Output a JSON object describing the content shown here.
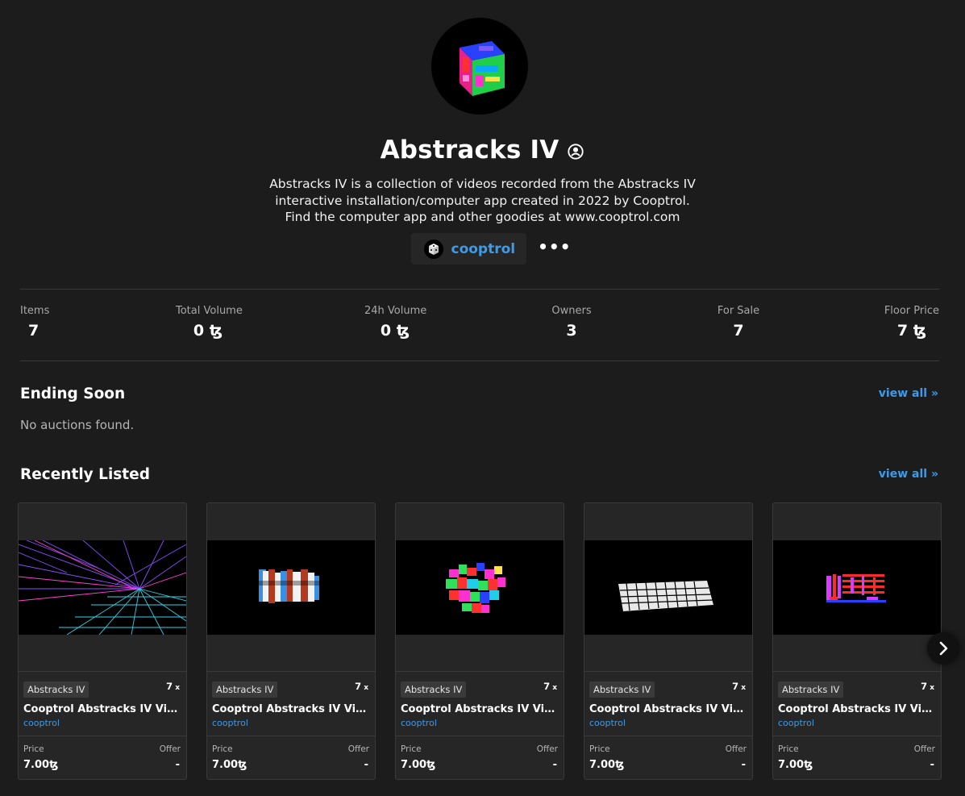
{
  "collection": {
    "title": "Abstracks IV",
    "description_lines": [
      "Abstracks IV is a collection of videos recorded from the Abstracks IV",
      "interactive installation/computer app created in 2022 by Cooptrol.",
      "Find the computer app and other goodies at www.cooptrol.com"
    ],
    "creator": "cooptrol",
    "more_label": "•••"
  },
  "stats": [
    {
      "label": "Items",
      "value": "7"
    },
    {
      "label": "Total Volume",
      "value": "0 ꜩ"
    },
    {
      "label": "24h Volume",
      "value": "0 ꜩ"
    },
    {
      "label": "Owners",
      "value": "3"
    },
    {
      "label": "For Sale",
      "value": "7"
    },
    {
      "label": "Floor Price",
      "value": "7 ꜩ"
    }
  ],
  "ending_soon": {
    "title": "Ending Soon",
    "view_all": "view all »",
    "empty": "No auctions found."
  },
  "recently_listed": {
    "title": "Recently Listed",
    "view_all": "view all »",
    "price_label": "Price",
    "offer_label": "Offer",
    "items": [
      {
        "tag": "Abstracks IV",
        "editions": "7",
        "editions_suffix": "x",
        "name": "Cooptrol Abstracks IV Video…",
        "artist": "cooptrol",
        "price": "7.00ꜩ",
        "offer": "-",
        "art": "wire-tunnel"
      },
      {
        "tag": "Abstracks IV",
        "editions": "7",
        "editions_suffix": "x",
        "name": "Cooptrol Abstracks IV Video…",
        "artist": "cooptrol",
        "price": "7.00ꜩ",
        "offer": "-",
        "art": "striped-shapes"
      },
      {
        "tag": "Abstracks IV",
        "editions": "7",
        "editions_suffix": "x",
        "name": "Cooptrol Abstracks IV Video…",
        "artist": "cooptrol",
        "price": "7.00ꜩ",
        "offer": "-",
        "art": "color-blocks"
      },
      {
        "tag": "Abstracks IV",
        "editions": "7",
        "editions_suffix": "x",
        "name": "Cooptrol Abstracks IV Video…",
        "artist": "cooptrol",
        "price": "7.00ꜩ",
        "offer": "-",
        "art": "white-grid"
      },
      {
        "tag": "Abstracks IV",
        "editions": "7",
        "editions_suffix": "x",
        "name": "Cooptrol Abstracks IV Video…",
        "artist": "cooptrol",
        "price": "7.00ꜩ",
        "offer": "-",
        "art": "red-bars"
      }
    ]
  },
  "colors": {
    "background": "#1c1c1c",
    "panel": "#262626",
    "accent": "#3d9be9",
    "border": "#3a3a3a"
  }
}
